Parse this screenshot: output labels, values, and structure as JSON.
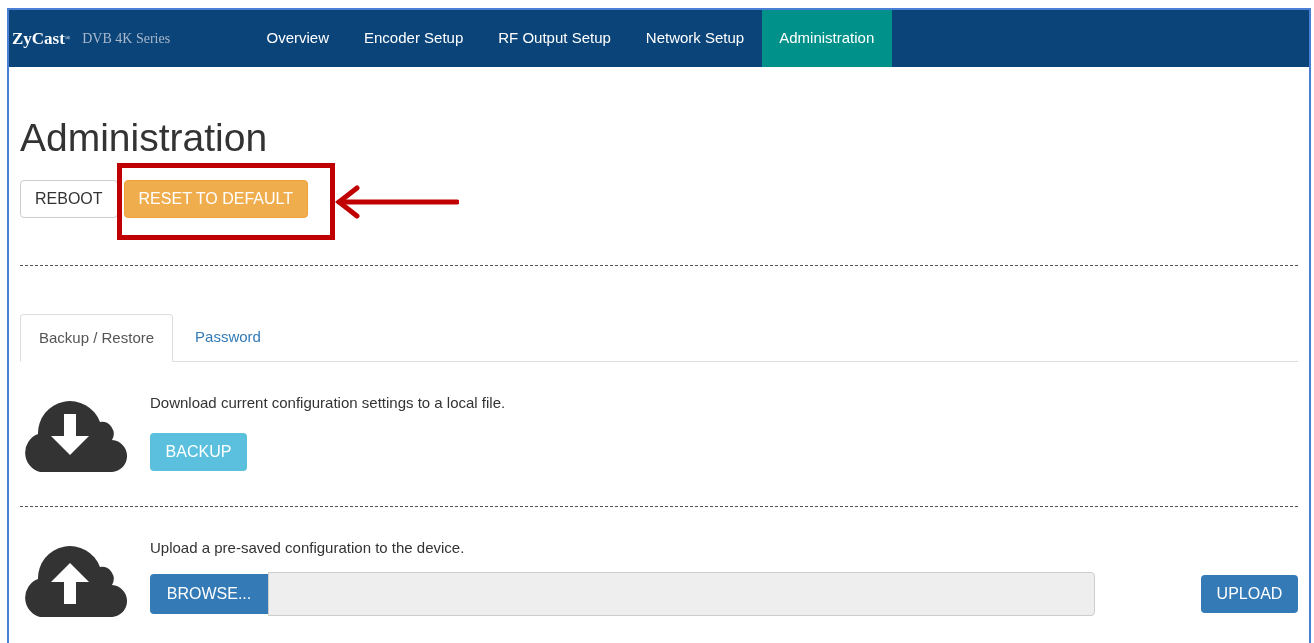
{
  "navbar": {
    "brand": "ZyCast",
    "brand_mark": "®",
    "series": "DVB 4K Series",
    "items": [
      {
        "label": "Overview",
        "selected": false
      },
      {
        "label": "Encoder Setup",
        "selected": false
      },
      {
        "label": "RF Output Setup",
        "selected": false
      },
      {
        "label": "Network Setup",
        "selected": false
      },
      {
        "label": "Administration",
        "selected": true
      }
    ]
  },
  "heading": "Administration",
  "actions": [
    {
      "label": "REBOOT",
      "kind": "default"
    },
    {
      "label": "RESET TO DEFAULT",
      "kind": "warning"
    }
  ],
  "tabs": [
    {
      "label": "Backup / Restore",
      "selected": true
    },
    {
      "label": "Password",
      "selected": false
    }
  ],
  "backup": {
    "text": "Download current configuration settings to a local file.",
    "button": "BACKUP"
  },
  "restore": {
    "text": "Upload a pre-saved configuration to the device.",
    "browse": "BROWSE...",
    "upload": "UPLOAD"
  }
}
